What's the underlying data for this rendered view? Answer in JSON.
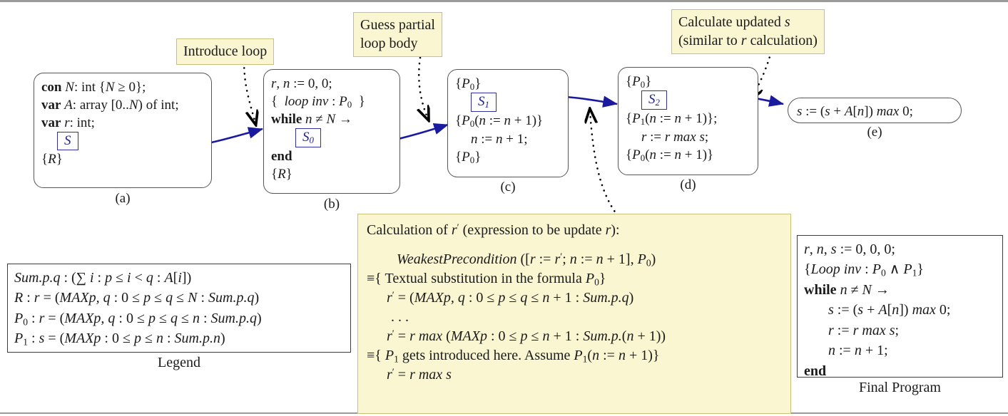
{
  "figure": {
    "title": "Stepwise derivation of maximum segment sum program",
    "colors": {
      "callout_fill": "#faf6d2",
      "callout_border": "#c9c07a",
      "arrow_blue": "#1a1a9e",
      "box_border": "#555555",
      "page_border": "#9a9a9a"
    }
  },
  "callouts": [
    {
      "id": "introduce-loop",
      "lines": [
        "Introduce loop"
      ]
    },
    {
      "id": "guess-partial-loop-body",
      "lines": [
        "Guess partial",
        "loop body"
      ]
    },
    {
      "id": "calculate-updated-s",
      "lines": [
        "Calculate updated s",
        "(similar to r calculation)"
      ]
    }
  ],
  "steps": [
    {
      "id": "a",
      "caption": "(a)",
      "lines": [
        "con N: int {N ≥ 0};",
        "var A: array [0..N) of int;",
        "var r: int;",
        "S",
        "{R}"
      ]
    },
    {
      "id": "b",
      "caption": "(b)",
      "lines": [
        "r, n := 0, 0;",
        "{  loop inv : P0  }",
        "while n ≠ N →",
        "S0",
        "end",
        "{R}"
      ]
    },
    {
      "id": "c",
      "caption": "(c)",
      "lines": [
        "{P0}",
        "S1",
        "{P0(n := n + 1)}",
        "n := n + 1;",
        "{P0}"
      ]
    },
    {
      "id": "d",
      "caption": "(d)",
      "lines": [
        "{P0}",
        "S2",
        "{P1(n := n + 1)};",
        "r := r max s;",
        "{P0(n := n + 1)}"
      ]
    },
    {
      "id": "e",
      "caption": "(e)",
      "lines": [
        "s := (s + A[n]) max 0;"
      ]
    }
  ],
  "legend": {
    "label": "Legend",
    "lines": [
      "Sum.p.q : (∑ i : p ≤ i < q : A[i])",
      "R : r = (MAXp, q : 0 ≤ p ≤ q ≤ N : Sum.p.q)",
      "P0 : r = (MAXp, q : 0 ≤ p ≤ q ≤ n : Sum.p.q)",
      "P1 : s = (MAXp : 0 ≤ p ≤ n : Sum.p.n)"
    ]
  },
  "calculation": {
    "heading": "Calculation of r′ (expression to be update r):",
    "lines": [
      "WeakestPrecondition ([r := r′; n := n + 1], P0)",
      "≡{ Textual substitution in the formula P0}",
      "r′ = (MAXp, q : 0 ≤ p ≤ q ≤ n + 1 : Sum.p.q)",
      ". . .",
      "r′ = r max (MAXp : 0 ≤ p ≤ n + 1 : Sum.p.(n + 1))",
      "≡{ P1 gets introduced here. Assume P1(n := n + 1)}",
      "r′ = r max s"
    ]
  },
  "final_program": {
    "label": "Final Program",
    "lines": [
      "r, n, s := 0, 0, 0;",
      "{Loop inv : P0 ∧ P1}",
      "while n ≠ N →",
      "s := (s + A[n]) max 0;",
      "r := r max s;",
      "n := n + 1;",
      "end"
    ]
  },
  "connectors": [
    {
      "id": "a-to-b",
      "kind": "solid-arrow",
      "from": "S",
      "to": "step-b"
    },
    {
      "id": "b-to-c",
      "kind": "solid-arrow",
      "from": "S0",
      "to": "step-c"
    },
    {
      "id": "c-to-d",
      "kind": "solid-arrow",
      "from": "S1",
      "to": "step-d"
    },
    {
      "id": "d-to-e",
      "kind": "solid-arrow",
      "from": "S2",
      "to": "step-e"
    },
    {
      "id": "introduce-loop-link",
      "kind": "dotted",
      "from": "introduce-loop",
      "to": "a-to-b"
    },
    {
      "id": "guess-partial-link",
      "kind": "dotted",
      "from": "guess-partial-loop-body",
      "to": "b-to-c"
    },
    {
      "id": "calculate-updated-s-link",
      "kind": "dotted",
      "from": "calculate-updated-s",
      "to": "d-to-e"
    },
    {
      "id": "calculation-link",
      "kind": "dotted",
      "from": "calculation",
      "to": "c-to-d"
    }
  ]
}
